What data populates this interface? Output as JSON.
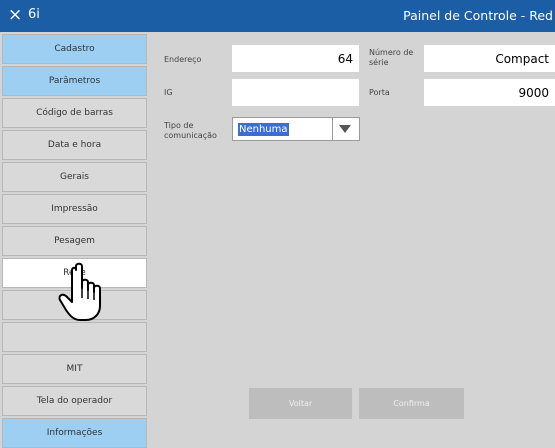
{
  "window": {
    "close_icon": "×",
    "app_name": "6i",
    "title": "Painel de Controle - Red",
    "titlebar_color": "#1b5ea6"
  },
  "sidebar": {
    "items": [
      {
        "label": "Cadastro",
        "style": "blue"
      },
      {
        "label": "Parâmetros",
        "style": "blue"
      },
      {
        "label": "Código de barras",
        "style": "gray"
      },
      {
        "label": "Data e hora",
        "style": "gray"
      },
      {
        "label": "Gerais",
        "style": "gray"
      },
      {
        "label": "Impressão",
        "style": "gray"
      },
      {
        "label": "Pesagem",
        "style": "gray"
      },
      {
        "label": "Rede",
        "style": "white-selected"
      },
      {
        "label": "",
        "style": "gray"
      },
      {
        "label": "",
        "style": "gray"
      },
      {
        "label": "MIT",
        "style": "gray"
      },
      {
        "label": "Tela do operador",
        "style": "gray"
      },
      {
        "label": "Informações",
        "style": "blue"
      }
    ],
    "accent_blue": "#9ccff1"
  },
  "form": {
    "endereco_label": "Endereço",
    "endereco_value": "64",
    "numero_serie_label": "Número de série",
    "numero_serie_value": "Compact",
    "ip_label": "IG",
    "ip_value": "",
    "porta_label": "Porta",
    "porta_value": "9000",
    "tipo_label": "Tipo de comunicação",
    "tipo_value": "Nenhuma"
  },
  "buttons": {
    "back_label": "Voltar",
    "confirm_label": "Confirma"
  },
  "cursor": {
    "icon": "hand-pointer-icon"
  }
}
